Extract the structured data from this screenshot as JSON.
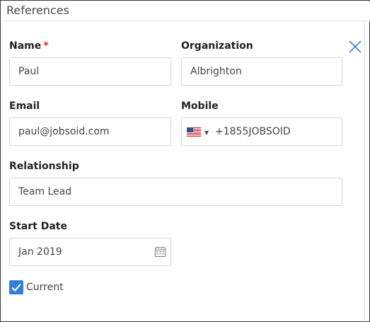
{
  "header": {
    "title": "References"
  },
  "form": {
    "name": {
      "label": "Name",
      "required_mark": "*",
      "value": "Paul"
    },
    "organization": {
      "label": "Organization",
      "value": "Albrighton"
    },
    "email": {
      "label": "Email",
      "value": "paul@jobsoid.com"
    },
    "mobile": {
      "label": "Mobile",
      "country_flag": "us-flag-icon",
      "value": "+1855JOBSOID"
    },
    "relationship": {
      "label": "Relationship",
      "value": "Team Lead"
    },
    "start_date": {
      "label": "Start Date",
      "value": "Jan 2019"
    },
    "current": {
      "label": "Current",
      "checked": true
    }
  },
  "colors": {
    "accent": "#2f7fd6",
    "required": "#e0262b",
    "close_icon": "#3b7fc9"
  }
}
